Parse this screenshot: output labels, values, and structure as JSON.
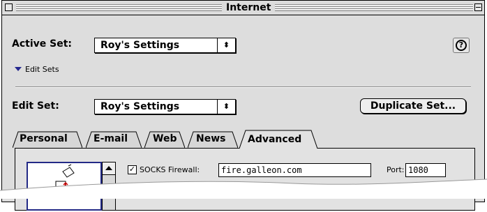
{
  "window": {
    "title": "Internet"
  },
  "active_set": {
    "label": "Active Set:",
    "value": "Roy's Settings"
  },
  "edit_sets_toggle": {
    "label": "Edit Sets"
  },
  "edit_set": {
    "label": "Edit Set:",
    "value": "Roy's Settings"
  },
  "duplicate_button": {
    "label": "Duplicate Set..."
  },
  "help_button": {
    "glyph": "?"
  },
  "tabs": [
    {
      "label": "Personal"
    },
    {
      "label": "E-mail"
    },
    {
      "label": "Web"
    },
    {
      "label": "News"
    },
    {
      "label": "Advanced",
      "selected": true
    }
  ],
  "advanced": {
    "socks": {
      "checked": true,
      "label": "SOCKS Firewall:",
      "value": "fire.galleon.com"
    },
    "port": {
      "label": "Port:",
      "value": "1080"
    }
  },
  "colors": {
    "window_bg": "#dddddd",
    "list_border": "#232a87"
  }
}
